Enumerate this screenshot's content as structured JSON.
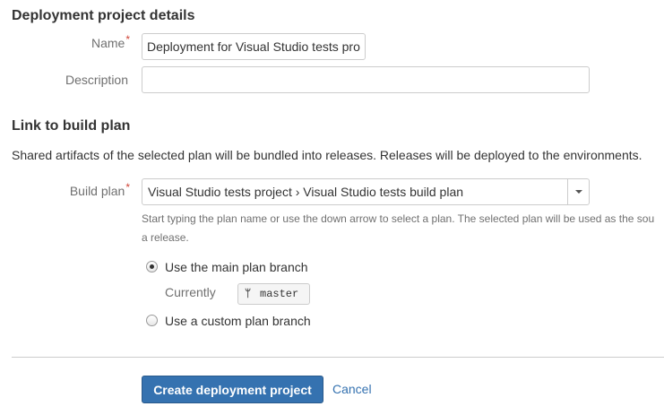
{
  "details": {
    "heading": "Deployment project details",
    "name_label": "Name",
    "name_value": "Deployment for Visual Studio tests pro",
    "description_label": "Description",
    "description_value": ""
  },
  "build": {
    "heading": "Link to build plan",
    "intro": "Shared artifacts of the selected plan will be bundled into releases. Releases will be deployed to the environments.",
    "plan_label": "Build plan",
    "plan_value": "Visual Studio tests project › Visual Studio tests build plan",
    "help_line1": "Start typing the plan name or use the down arrow to select a plan. The selected plan will be used as the sou",
    "help_line2": "a release.",
    "branch_options": {
      "main": {
        "label": "Use the main plan branch",
        "checked": true
      },
      "custom": {
        "label": "Use a custom plan branch",
        "checked": false
      }
    },
    "currently_label": "Currently",
    "branch_name": "master",
    "branch_icon": "branch-icon"
  },
  "actions": {
    "create_label": "Create deployment project",
    "cancel_label": "Cancel"
  },
  "colors": {
    "primary": "#3572b0",
    "required": "#d04437",
    "muted": "#707070"
  }
}
